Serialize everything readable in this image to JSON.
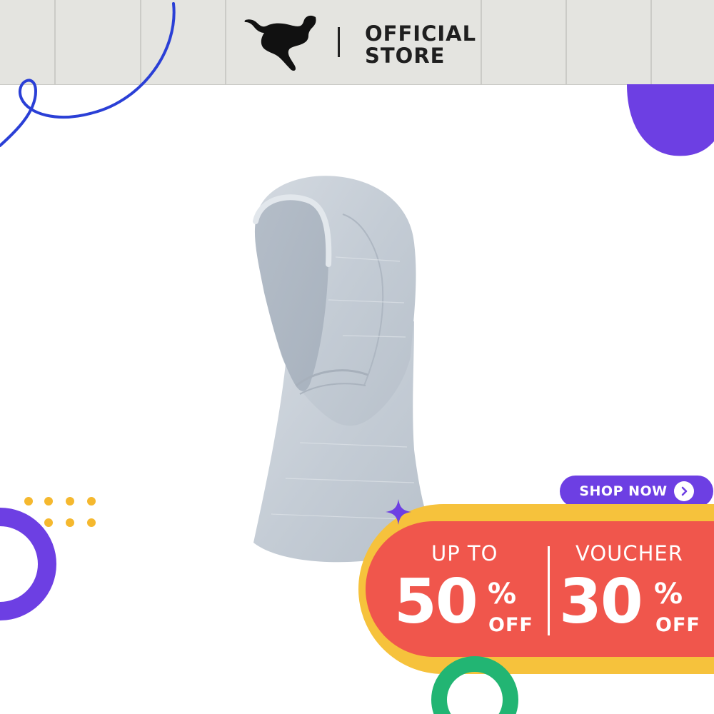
{
  "header": {
    "brand_logo_icon": "puma-cat-logo",
    "store_label": {
      "line1": "OFFICIAL",
      "line2": "STORE"
    }
  },
  "product": {
    "icon": "sports-hijab-product",
    "color": "#c9d0d8"
  },
  "cta": {
    "label": "SHOP NOW",
    "icon": "chevron-right-circle-icon",
    "color": "#6d3fe3"
  },
  "promo": {
    "discount": {
      "top": "UP TO",
      "number": "50",
      "percent": "%",
      "suffix": "OFF"
    },
    "voucher": {
      "top": "VOUCHER",
      "number": "30",
      "percent": "%",
      "suffix": "OFF"
    },
    "colors": {
      "outer": "#f6c23c",
      "inner": "#f0564c",
      "text": "#ffffff"
    }
  },
  "decorations": {
    "squiggle_color": "#2a3fd6",
    "purple": "#6d3fe3",
    "dots": "#f5b82e",
    "ring_green": "#22b573"
  }
}
